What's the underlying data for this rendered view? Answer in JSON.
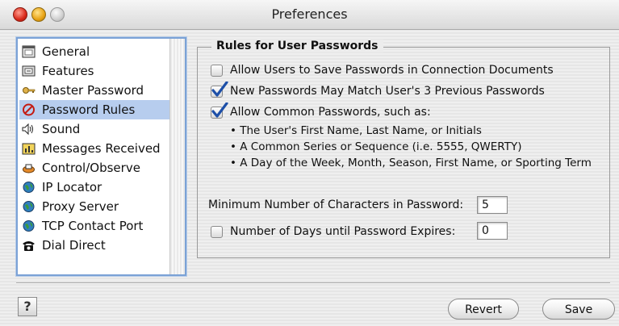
{
  "window": {
    "title": "Preferences"
  },
  "sidebar": {
    "items": [
      {
        "label": "General",
        "icon": "window-icon"
      },
      {
        "label": "Features",
        "icon": "features-icon"
      },
      {
        "label": "Master Password",
        "icon": "key-icon"
      },
      {
        "label": "Password Rules",
        "icon": "prohibited-icon",
        "selected": true
      },
      {
        "label": "Sound",
        "icon": "speaker-icon"
      },
      {
        "label": "Messages Received",
        "icon": "messages-icon"
      },
      {
        "label": "Control/Observe",
        "icon": "control-icon"
      },
      {
        "label": "IP Locator",
        "icon": "globe-icon"
      },
      {
        "label": "Proxy Server",
        "icon": "globe-icon"
      },
      {
        "label": "TCP Contact Port",
        "icon": "globe-icon"
      },
      {
        "label": "Dial Direct",
        "icon": "telephone-icon"
      }
    ]
  },
  "rules": {
    "title": "Rules for User Passwords",
    "options": [
      {
        "label": "Allow Users to Save Passwords in Connection Documents",
        "checked": false
      },
      {
        "label": "New Passwords May Match User's 3 Previous Passwords",
        "checked": true
      },
      {
        "label": "Allow Common Passwords, such as:",
        "checked": true
      }
    ],
    "examples": [
      "•  The User's First Name, Last Name, or Initials",
      "•  A Common Series or Sequence (i.e. 5555, QWERTY)",
      "•  A Day of the Week, Month, Season, First Name, or Sporting Term"
    ],
    "min_chars_label": "Minimum Number of Characters in Password:",
    "min_chars_value": "5",
    "expire_label": "Number of Days until Password Expires:",
    "expire_value": "0",
    "expire_checked": false
  },
  "footer": {
    "help_label": "?",
    "revert_label": "Revert",
    "save_label": "Save"
  },
  "colors": {
    "selection": "#b7cdee",
    "checkmark": "#1d4fa8",
    "focus_ring": "#7ba2d6"
  }
}
